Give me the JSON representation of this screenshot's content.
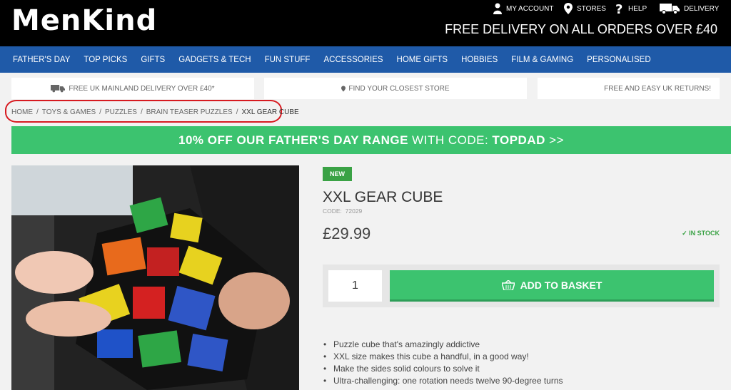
{
  "brand": {
    "logo": "MenKind"
  },
  "utility": {
    "account": "MY ACCOUNT",
    "stores": "STORES",
    "help": "HELP",
    "delivery": "DELIVERY",
    "free_delivery": "FREE DELIVERY ON ALL ORDERS OVER £40"
  },
  "nav": {
    "items": [
      "FATHER'S DAY",
      "TOP PICKS",
      "GIFTS",
      "GADGETS & TECH",
      "FUN STUFF",
      "ACCESSORIES",
      "HOME GIFTS",
      "HOBBIES",
      "FILM & GAMING",
      "PERSONALISED"
    ]
  },
  "info_bar": {
    "delivery": "FREE UK MAINLAND DELIVERY OVER £40*",
    "store": "FIND YOUR CLOSEST STORE",
    "returns": "FREE AND EASY UK RETURNS!"
  },
  "breadcrumbs": {
    "items": [
      "HOME",
      "TOYS & GAMES",
      "PUZZLES",
      "BRAIN TEASER PUZZLES"
    ],
    "current": "XXL GEAR CUBE",
    "separator": "/"
  },
  "promo": {
    "bold": "10% OFF OUR FATHER'S DAY RANGE",
    "mid": " WITH CODE: ",
    "code": "TOPDAD",
    "arrow": " >>"
  },
  "product": {
    "badge": "NEW",
    "title": "XXL GEAR CUBE",
    "code": "CODE:  72029",
    "price": "£29.99",
    "stock": "✓ IN STOCK",
    "quantity": "1",
    "add_label": "ADD TO BASKET",
    "bullets": [
      "Puzzle cube that's amazingly addictive",
      "XXL size makes this cube a handful, in a good way!",
      "Make the sides solid colours to solve it",
      "Ultra-challenging: one rotation needs twelve 90-degree turns"
    ]
  },
  "colors": {
    "header_bg": "#000000",
    "nav_bg": "#1f5aa8",
    "promo_green": "#3cc36f",
    "badge_green": "#3aa245",
    "highlight_red": "#d71a20"
  }
}
